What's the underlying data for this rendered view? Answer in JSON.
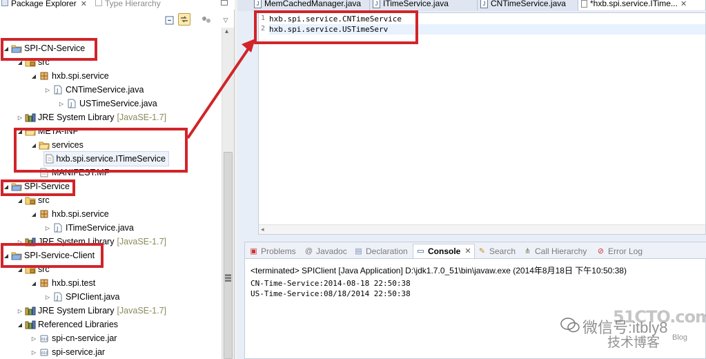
{
  "left_panel": {
    "tabs": [
      {
        "label": "Package Explorer",
        "close": "✕"
      },
      {
        "label": "Type Hierarchy"
      }
    ],
    "tree": [
      {
        "label": "SPI-CN-Service",
        "decoration": ""
      },
      {
        "label": "src",
        "decoration": ""
      },
      {
        "label": "hxb.spi.service",
        "decoration": ""
      },
      {
        "label": "CNTimeService.java",
        "decoration": ""
      },
      {
        "label": "USTimeService.java",
        "decoration": ""
      },
      {
        "label": "JRE System Library",
        "decoration": "[JavaSE-1.7]"
      },
      {
        "label": "META-INF",
        "decoration": ""
      },
      {
        "label": "services",
        "decoration": ""
      },
      {
        "label": "hxb.spi.service.ITimeService",
        "decoration": ""
      },
      {
        "label": "MANIFEST.MF",
        "decoration": ""
      },
      {
        "label": "SPI-Service",
        "decoration": ""
      },
      {
        "label": "src",
        "decoration": ""
      },
      {
        "label": "hxb.spi.service",
        "decoration": ""
      },
      {
        "label": "ITimeService.java",
        "decoration": ""
      },
      {
        "label": "JRE System Library",
        "decoration": "[JavaSE-1.7]"
      },
      {
        "label": "SPI-Service-Client",
        "decoration": ""
      },
      {
        "label": "src",
        "decoration": ""
      },
      {
        "label": "hxb.spi.test",
        "decoration": ""
      },
      {
        "label": "SPIClient.java",
        "decoration": ""
      },
      {
        "label": "JRE System Library",
        "decoration": "[JavaSE-1.7]"
      },
      {
        "label": "Referenced Libraries",
        "decoration": ""
      },
      {
        "label": "spi-cn-service.jar",
        "decoration": ""
      },
      {
        "label": "spi-service.jar",
        "decoration": ""
      }
    ]
  },
  "editor": {
    "tabs": [
      {
        "label": "MemCachedManager.java"
      },
      {
        "label": "ITimeService.java"
      },
      {
        "label": "CNTimeService.java"
      },
      {
        "label": "*hxb.spi.service.ITime...",
        "close": "✕"
      }
    ],
    "lines": [
      {
        "num": "1",
        "text": "hxb.spi.service.CNTimeService"
      },
      {
        "num": "2",
        "text": "hxb.spi.service.USTimeServ"
      }
    ]
  },
  "console": {
    "tabs": [
      {
        "label": "Problems"
      },
      {
        "label": "Javadoc"
      },
      {
        "label": "Declaration"
      },
      {
        "label": "Console",
        "close": "✕"
      },
      {
        "label": "Search"
      },
      {
        "label": "Call Hierarchy"
      },
      {
        "label": "Error Log"
      }
    ],
    "status": "<terminated> SPIClient [Java Application] D:\\jdk1.7.0_51\\bin\\javaw.exe (2014年8月18日 下午10:50:38)",
    "output": [
      "CN-Time-Service:2014-08-18 22:50:38",
      "US-Time-Service:08/18/2014 22:50:38"
    ]
  },
  "watermark": {
    "site": "51CTO.com",
    "wechat": "微信号:itbly8",
    "blog_cn": "技术博客",
    "blog": "Blog"
  },
  "icons": {
    "project": "open-folder-icon",
    "source_folder": "package-folder-icon",
    "package": "package-icon",
    "java_file": "java-file-icon",
    "library": "library-icon",
    "jar": "jar-icon"
  },
  "colors": {
    "annotation": "#d0252a",
    "decoration": "#8a8a5a",
    "editor_bg": "#e8eef7"
  }
}
